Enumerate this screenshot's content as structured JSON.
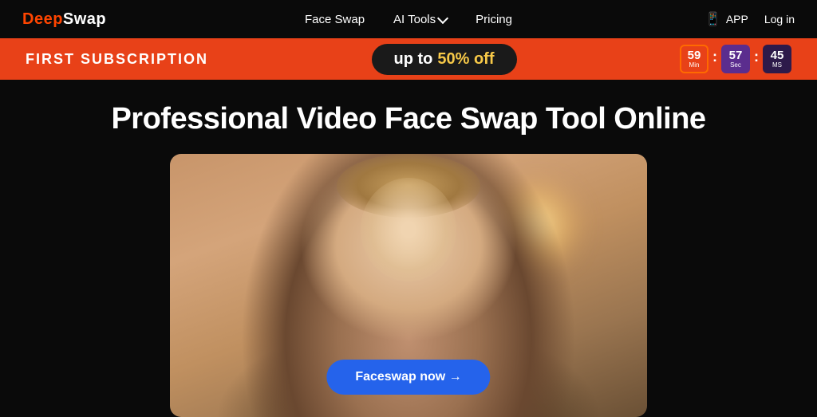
{
  "navbar": {
    "logo": "DeepSwap",
    "links": [
      {
        "label": "Face Swap",
        "id": "face-swap"
      },
      {
        "label": "AI Tools",
        "id": "ai-tools",
        "hasDropdown": true
      },
      {
        "label": "Pricing",
        "id": "pricing"
      }
    ],
    "app_label": "APP",
    "login_label": "Log in"
  },
  "promo": {
    "left_text": "FIRST SUBSCRIPTION",
    "center_prefix": "up to",
    "center_highlight": "50% off",
    "timer": {
      "minutes": "59",
      "seconds": "57",
      "ms": "45",
      "min_label": "Min",
      "sec_label": "Sec",
      "ms_label": "MS"
    }
  },
  "hero": {
    "title": "Professional Video Face Swap Tool Online",
    "cta_button": "Faceswap now →"
  }
}
